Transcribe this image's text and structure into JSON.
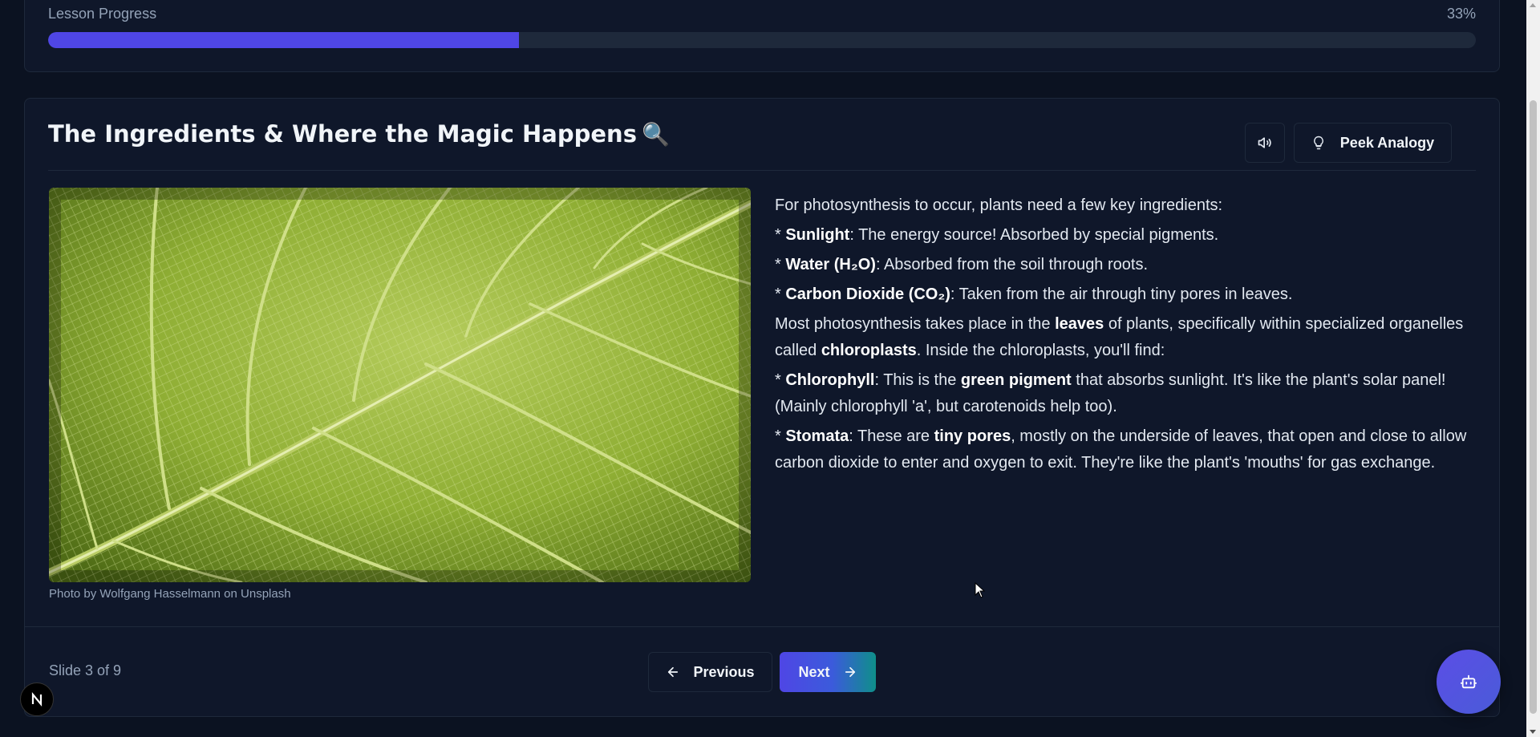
{
  "progress": {
    "label": "Lesson Progress",
    "percent_text": "33%",
    "value": 0.33,
    "fill_color": "#4f46e5"
  },
  "slide": {
    "title": "The Ingredients & Where the Magic Happens",
    "title_emoji": "🔍",
    "audio_icon": "speaker-icon",
    "analogy_label": "Peek Analogy",
    "analogy_icon": "lightbulb-icon",
    "image_icon": "leaf-photo",
    "photo_credit": "Photo by Wolfgang Hasselmann on Unsplash",
    "content": {
      "intro": "For photosynthesis to occur, plants need a few key ingredients:",
      "bullet_prefix": "* ",
      "sunlight_term": "Sunlight",
      "sunlight_text": ": The energy source! Absorbed by special pigments.",
      "water_term": "Water (H₂O)",
      "water_text": ": Absorbed from the soil through roots.",
      "co2_term": "Carbon Dioxide (CO₂)",
      "co2_text": ": Taken from the air through tiny pores in leaves.",
      "leaves_pre": "Most photosynthesis takes place in the ",
      "leaves_term": "leaves",
      "leaves_mid": " of plants, specifically within specialized organelles called ",
      "chloroplasts_term": "chloroplasts",
      "leaves_post": ". Inside the chloroplasts, you'll find:",
      "chlorophyll_term": "Chlorophyll",
      "chlorophyll_pre": ": This is the ",
      "green_pigment_term": "green pigment",
      "chlorophyll_post": " that absorbs sunlight. It's like the plant's solar panel! (Mainly chlorophyll 'a', but carotenoids help too).",
      "stomata_term": "Stomata",
      "stomata_pre": ": These are ",
      "tiny_pores_term": "tiny pores",
      "stomata_post": ", mostly on the underside of leaves, that open and close to allow carbon dioxide to enter and oxygen to exit. They're like the plant's 'mouths' for gas exchange."
    }
  },
  "footer": {
    "counter": "Slide 3 of 9",
    "prev_label": "Previous",
    "prev_icon": "arrow-left-icon",
    "next_label": "Next",
    "next_icon": "arrow-right-icon"
  },
  "assistant_fab_icon": "robot-icon",
  "dev_badge_icon": "nextjs-logo"
}
